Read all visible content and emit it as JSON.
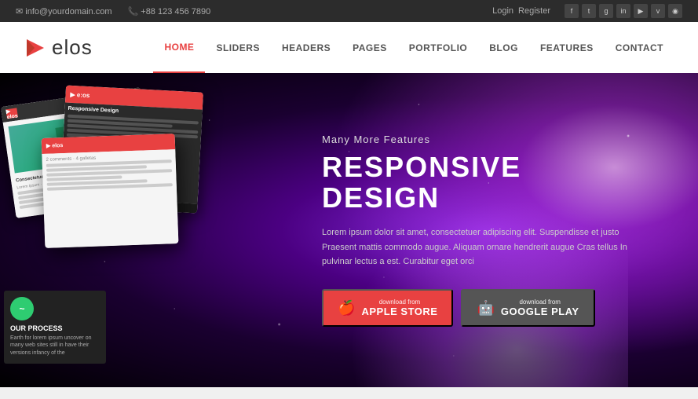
{
  "topbar": {
    "email": "info@yourdomain.com",
    "phone": "+88 123 456 7890",
    "login": "Login",
    "register": "Register",
    "social": [
      "f",
      "t",
      "g+",
      "in",
      "yt",
      "vm",
      "rss"
    ]
  },
  "logo": {
    "text": "elos"
  },
  "nav": {
    "items": [
      {
        "label": "HOME",
        "active": true
      },
      {
        "label": "SLIDERS",
        "active": false
      },
      {
        "label": "HEADERS",
        "active": false
      },
      {
        "label": "PAGES",
        "active": false
      },
      {
        "label": "PORTFOLIO",
        "active": false
      },
      {
        "label": "BLOG",
        "active": false
      },
      {
        "label": "FEATURES",
        "active": false
      },
      {
        "label": "CONTACT",
        "active": false
      }
    ]
  },
  "hero": {
    "subtitle": "Many More Features",
    "title": "RESPONSIVE DESIGN",
    "description": "Lorem ipsum dolor sit amet, consectetuer adipiscing elit. Suspendisse et justo Praesent mattis commodo augue. Aliquam ornare hendrerit augue Cras tellus In pulvinar lectus a est. Curabitur eget orci",
    "btn_apple_small": "download from",
    "btn_apple_large": "APPLE STORE",
    "btn_google_small": "download from",
    "btn_google_large": "GOOGLE PLAY",
    "process_title": "OUR PROCESS",
    "process_text": "Earth for lorem ipsum uncover on many web sites still in have their versions infancy of the"
  }
}
